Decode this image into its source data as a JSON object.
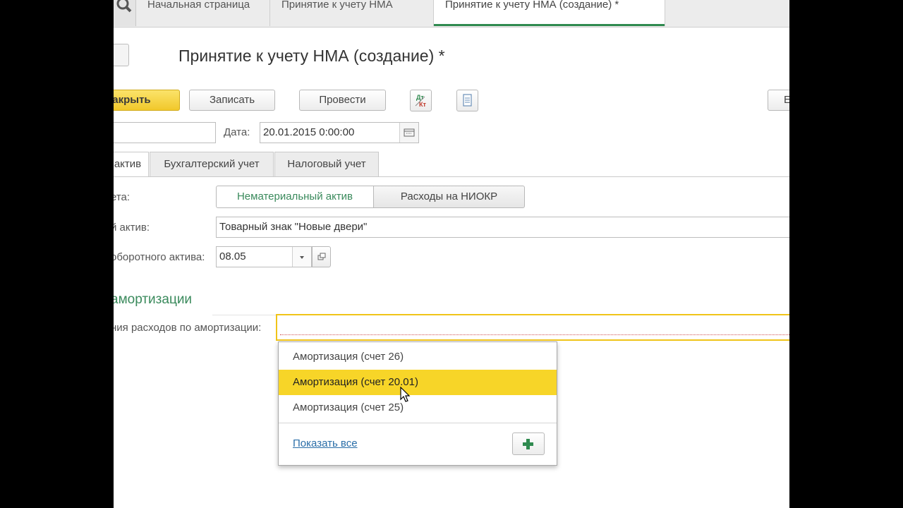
{
  "tabs": [
    {
      "label": "Начальная страница"
    },
    {
      "label": "Принятие к учету НМА"
    },
    {
      "label": "Принятие к учету НМА (создание) *"
    }
  ],
  "page": {
    "title": "Принятие к учету НМА (создание) *"
  },
  "toolbar": {
    "post_close": "закрыть",
    "save": "Записать",
    "post": "Провести",
    "dt_kt_top": "Дт",
    "dt_kt_bottom": "Кт",
    "more": "Е"
  },
  "header_fields": {
    "date_label": "Дата:",
    "date_value": "20.01.2015  0:00:00"
  },
  "form_tabs": [
    "актив",
    "Бухгалтерский учет",
    "Налоговый учет"
  ],
  "form": {
    "account_label": "ета:",
    "segment_options": [
      "Нематериальный актив",
      "Расходы на НИОКР"
    ],
    "asset_label": "й актив:",
    "asset_value": "Товарный знак \"Новые двери\"",
    "noncurrent_label": "оборотного актива:",
    "noncurrent_value": "08.05",
    "section_title": "амортизации",
    "expense_label": "ния расходов по амортизации:",
    "expense_value": ""
  },
  "dropdown": {
    "items": [
      "Амортизация (счет 26)",
      "Амортизация (счет 20.01)",
      "Амортизация (счет 25)"
    ],
    "selected_index": 1,
    "show_all": "Показать все"
  },
  "colors": {
    "accent_green": "#3a8a5c",
    "highlight_yellow": "#f7d528",
    "primary_button": "#f1c82b",
    "link_blue": "#2a6ea8"
  }
}
